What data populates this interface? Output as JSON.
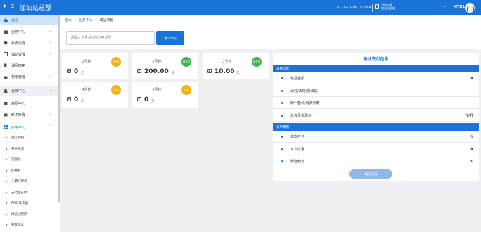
{
  "header": {
    "brand": "加油站总部",
    "datetime": "2021-10-18 15:53:42",
    "store_line1": "当前店铺",
    "store_line2": "加油站总部",
    "username": "MYK1"
  },
  "sidebar": {
    "items": [
      {
        "label": "首页"
      },
      {
        "label": "业务中心"
      },
      {
        "label": "系统设置"
      },
      {
        "label": "油站设置"
      },
      {
        "label": "油品ERP"
      },
      {
        "label": "权限管理"
      },
      {
        "label": "会员中心"
      },
      {
        "label": "商品中心"
      },
      {
        "label": "ERP库管"
      },
      {
        "label": "应用中心"
      }
    ],
    "subitems": [
      "短信营销",
      "积分商城",
      "交接班",
      "优惠券",
      "小票打印机",
      "支付宝支付",
      "RFID读卡器",
      "微信小程序",
      "开支流水"
    ]
  },
  "breadcrumb": {
    "home": "首页",
    "section": "业务中心",
    "current": "油品收银"
  },
  "search": {
    "placeholder": "请输入卡号/身份证/电话号",
    "button": "读卡(B)"
  },
  "pumps": [
    {
      "name": "1号枪",
      "status": "空闲",
      "amount": "0",
      "unit": "元"
    },
    {
      "name": "2号枪",
      "status": "待支付",
      "amount": "200.00",
      "unit": "元"
    },
    {
      "name": "3号枪",
      "status": "待支付",
      "amount": "10.00",
      "unit": "元"
    },
    {
      "name": "4号枪",
      "status": "空闲",
      "amount": "0",
      "unit": "元"
    },
    {
      "name": "5号枪",
      "status": "空闲",
      "amount": "0",
      "unit": "元"
    }
  ],
  "payment": {
    "title": "确认支付信息",
    "consume_section": "消费信息",
    "consume_rows": [
      {
        "label": "机显金额",
        "value": "¥"
      },
      {
        "label": "油号/油枪/加油机",
        "value": ""
      },
      {
        "label": "统一售价/消费升数",
        "value": ""
      },
      {
        "label": "非会员优惠价",
        "value": "元/升"
      }
    ],
    "order_section": "订单费用",
    "order_rows": [
      {
        "label": "本次应付",
        "value": "¥"
      },
      {
        "label": "本次优惠",
        "value": "¥"
      },
      {
        "label": "赠送积分",
        "value": "0"
      }
    ],
    "confirm_button": "确认支付"
  },
  "colors": {
    "primary": "#1a73d9",
    "idle": "#f3b11a",
    "paying": "#3eb551",
    "price": "#e24b4b"
  }
}
